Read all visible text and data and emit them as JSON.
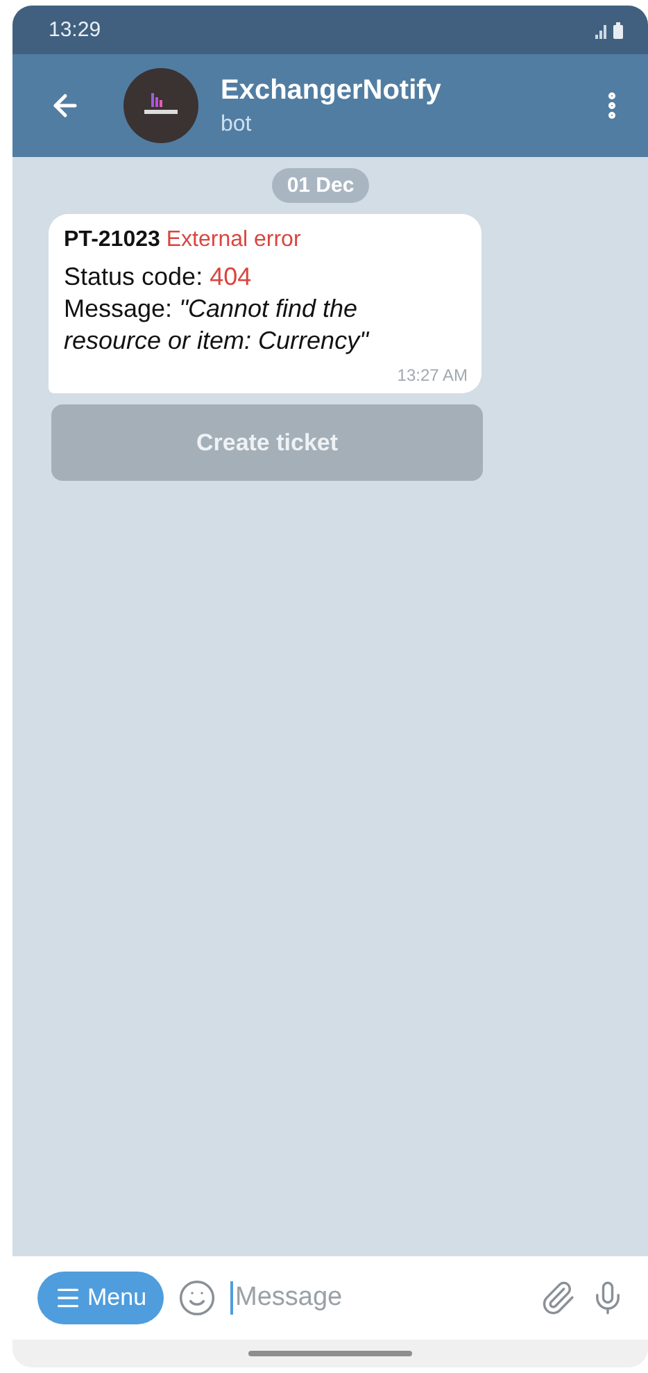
{
  "status_bar": {
    "time": "13:29"
  },
  "header": {
    "title": "ExchangerNotify",
    "subtitle": "bot"
  },
  "date_chip": "01 Dec",
  "message": {
    "code": "PT-21023",
    "error": "External error",
    "status_label": "Status code:",
    "status_value": "404",
    "message_label": "Message:",
    "message_text": "\"Cannot find the resource or item: Currency\"",
    "time": "13:27 AM"
  },
  "inline_button": {
    "label": "Create ticket"
  },
  "composer": {
    "menu_label": "Menu",
    "placeholder": "Message"
  }
}
